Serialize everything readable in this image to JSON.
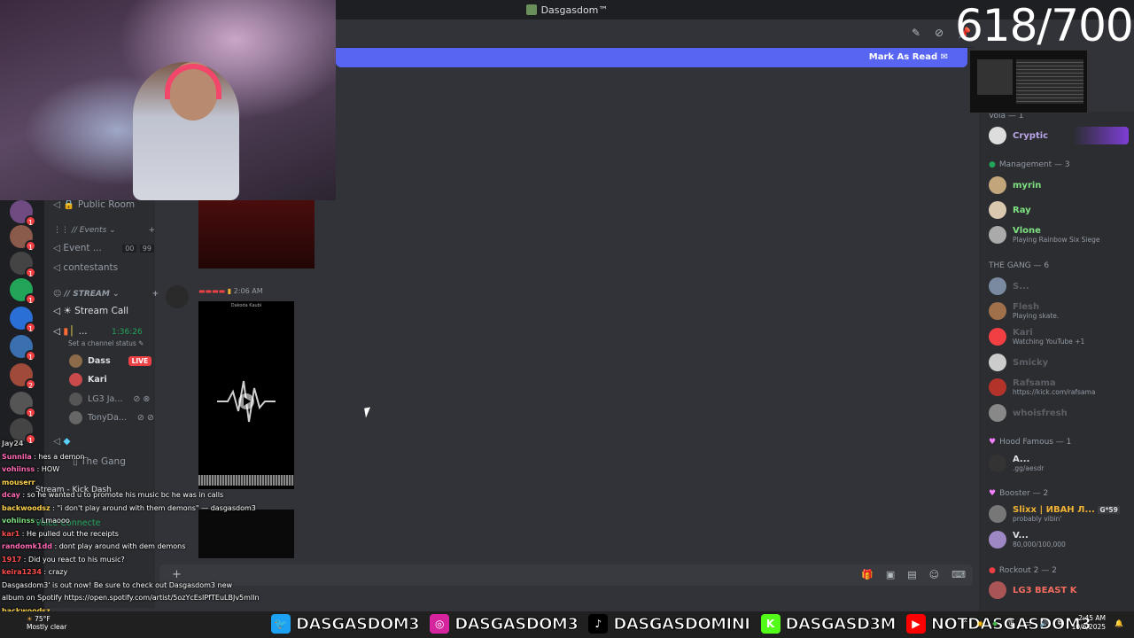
{
  "window": {
    "title": "Dasgasdom™"
  },
  "counter": "618/700",
  "banner": {
    "mark_read": "Mark As Read"
  },
  "channels": {
    "public_room": "Public Room",
    "events_cat": "// Events",
    "event_item": "Event ...",
    "event_count": "00",
    "event_limit": "99",
    "contestants": "contestants",
    "stream_cat": "// STREAM",
    "stream_call": "Stream Call",
    "active_channel": "...",
    "active_timer": "1:36:26",
    "channel_status": "Set a channel status",
    "the_gang": "The Gang",
    "stream_kick": "Stream - Kick Dash",
    "voice_connected": "Voice Connecte"
  },
  "voice_users": [
    {
      "name": "Dass",
      "badge": "LIVE",
      "color": "#dbdee1"
    },
    {
      "name": "Kari",
      "badge": "",
      "color": "#dbdee1"
    },
    {
      "name": "LG3 Ja...",
      "badge": "",
      "color": "#949ba4"
    },
    {
      "name": "TonyDa...",
      "badge": "",
      "color": "#949ba4"
    }
  ],
  "message": {
    "time": "2:06 AM",
    "phone_title": "Dakoda Kaubi"
  },
  "members": {
    "groups": [
      {
        "label": "Vola — 1"
      },
      {
        "label": "Management — 3"
      },
      {
        "label": "THE GANG — 6"
      },
      {
        "label": "Hood Famous — 1"
      },
      {
        "label": "Booster — 2"
      },
      {
        "label": "Rockout 2 — 2"
      }
    ],
    "people": [
      {
        "name": "Cryptic",
        "status": "",
        "color": "#b9a5e8"
      },
      {
        "name": "myrin",
        "status": "",
        "color": "#7ee080"
      },
      {
        "name": "Ray",
        "status": "",
        "color": "#7ee080"
      },
      {
        "name": "Vlone",
        "status": "Playing Rainbow Six Siege",
        "color": "#7ee080"
      },
      {
        "name": "S...",
        "status": "",
        "color": "#949ba4"
      },
      {
        "name": "Flesh",
        "status": "Playing skate.",
        "color": "#949ba4"
      },
      {
        "name": "Kari",
        "status": "Watching YouTube +1",
        "color": "#949ba4"
      },
      {
        "name": "Smicky",
        "status": "",
        "color": "#949ba4"
      },
      {
        "name": "Rafsama",
        "status": "https://kick.com/rafsama",
        "color": "#949ba4"
      },
      {
        "name": "whoisfresh",
        "status": "",
        "color": "#949ba4"
      },
      {
        "name": "A...",
        "status": ".gg/aesdr",
        "color": "#dbdee1"
      },
      {
        "name": "Slixx | ИВАН Л...",
        "status": "probably vibin'",
        "color": "#f0b232",
        "tag": "G*59"
      },
      {
        "name": "V...",
        "status": "80,000/100,000",
        "color": "#dbdee1"
      },
      {
        "name": "LG3 BEAST K",
        "status": "",
        "color": "#f26b5e"
      }
    ]
  },
  "chat": [
    {
      "user": "Jay24",
      "text": "",
      "color": "#bbbbbb"
    },
    {
      "user": "Sunnila",
      "text": "hes a demon",
      "color": "#ff69b4"
    },
    {
      "user": "vohiinss",
      "text": "HOW",
      "color": "#ff69b4"
    },
    {
      "user": "mouserr",
      "text": "",
      "color": "#ffd34d"
    },
    {
      "user": "dcay",
      "text": "so he wanted u to promote his music bc he was in calls",
      "color": "#ff69b4"
    },
    {
      "user": "backwoodsz",
      "text": "\"i don't play around with them demons\" — dasgasdom3",
      "color": "#ffd34d"
    },
    {
      "user": "vohiinss",
      "text": "Lmaooo",
      "color": "#7ee080"
    },
    {
      "user": "kar1",
      "text": "He pulled out the receipts",
      "color": "#ff4d4d"
    },
    {
      "user": "randomk1dd",
      "text": "dont play around with dem demons",
      "color": "#ff69b4"
    },
    {
      "user": "1917",
      "text": "Did you react to his music?",
      "color": "#ff4d4d"
    },
    {
      "user": "keira1234",
      "text": "crazy",
      "color": "#ff4d4d"
    },
    {
      "user": "",
      "text": "Dasgasdom3' is out now! Be sure to check out Dasgasdom3 new",
      "color": "#ffffff"
    },
    {
      "user": "",
      "text": "album on Spotify https://open.spotify.com/artist/5ozYcEsIPfTEuLBJv5mlIn",
      "color": "#ffffff"
    },
    {
      "user": "backwoodsz",
      "text": "",
      "color": "#ffd34d"
    }
  ],
  "socials": [
    {
      "icon": "twitter-icon",
      "glyph": "🐦",
      "bg": "#1da1f2",
      "handle": "DASGASDOM3"
    },
    {
      "icon": "instagram-icon",
      "glyph": "◎",
      "bg": "#d6249f",
      "handle": "DASGASDOM3"
    },
    {
      "icon": "tiktok-icon",
      "glyph": "♪",
      "bg": "#000000",
      "handle": "DASGASDOMINI"
    },
    {
      "icon": "kick-icon",
      "glyph": "K",
      "bg": "#53fc18",
      "handle": "DASGASD3M"
    },
    {
      "icon": "youtube-icon",
      "glyph": "▶",
      "bg": "#ff0000",
      "handle": "NOTDASGASDOM3"
    }
  ],
  "taskbar": {
    "weather": "75°F",
    "weather_desc": "Mostly clear",
    "time": "2:45 AM",
    "date": "10/6/2025"
  }
}
